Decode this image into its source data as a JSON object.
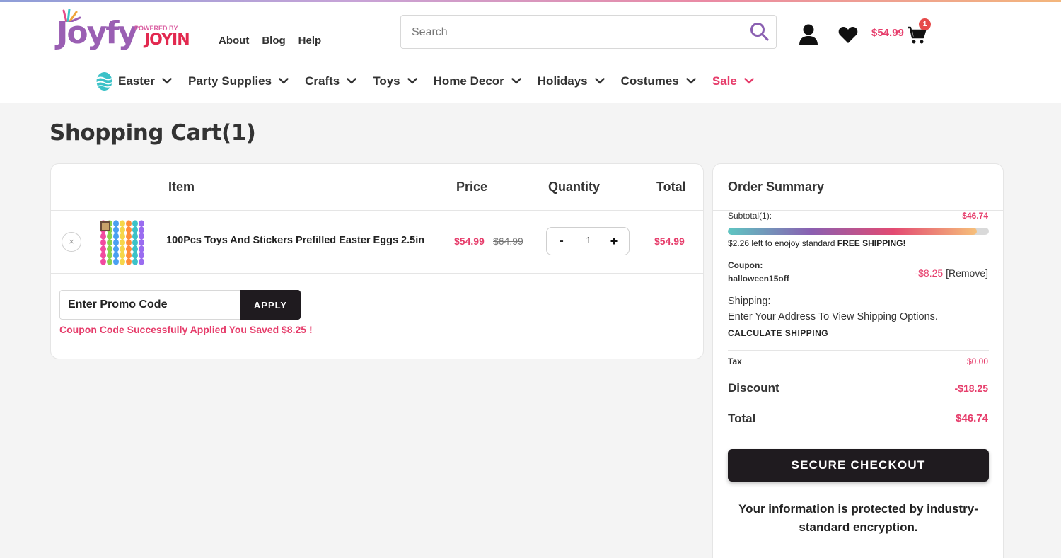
{
  "brand": {
    "logo_text": "Joyfy",
    "powered_by": "POWERED BY",
    "sub_brand": "JOYIN",
    "accent_color": "#e63d6b",
    "dark_color": "#1f1b1f"
  },
  "header": {
    "util_links": [
      "About",
      "Blog",
      "Help"
    ],
    "search_placeholder": "Search",
    "cart_amount": "$54.99",
    "cart_count": "1"
  },
  "nav": {
    "items": [
      "Easter",
      "Party Supplies",
      "Crafts",
      "Toys",
      "Home Decor",
      "Holidays",
      "Costumes",
      "Sale"
    ]
  },
  "page_title": "Shopping Cart(1)",
  "cart": {
    "columns": {
      "item": "Item",
      "price": "Price",
      "quantity": "Quantity",
      "total": "Total"
    },
    "rows": [
      {
        "remove": "×",
        "name": "100Pcs Toys And Stickers Prefilled Easter Eggs 2.5in",
        "price_sale": "$54.99",
        "price_original": "$64.99",
        "qty_minus": "-",
        "quantity": "1",
        "qty_plus": "+",
        "total": "$54.99"
      }
    ],
    "promo_placeholder": "Enter Promo Code",
    "apply_label": "APPLY",
    "promo_message": "Coupon Code Successfully Applied You Saved $8.25 !"
  },
  "summary": {
    "title": "Order Summary",
    "subtotal_label": "Subtotal(1):",
    "subtotal_value": "$46.74",
    "shipping_progress": 0.954,
    "free_ship_amount": "$2.26",
    "free_ship_text": "left to enojoy standard",
    "free_ship_bold": "FREE SHIPPING!",
    "coupon_label": "Coupon:",
    "coupon_code": "halloween15off",
    "coupon_value": "-$8.25",
    "coupon_remove": "[Remove]",
    "shipping_label": "Shipping:",
    "shipping_text": "Enter Your Address To View Shipping Options.",
    "calc_shipping": "CALCULATE SHIPPING",
    "tax_label": "Tax",
    "tax_value": "$0.00",
    "discount_label": "Discount",
    "discount_value": "-$18.25",
    "total_label": "Total",
    "total_value": "$46.74",
    "checkout_label": "SECURE CHECKOUT",
    "secure_note": "Your information is protected by industry-standard encryption."
  }
}
